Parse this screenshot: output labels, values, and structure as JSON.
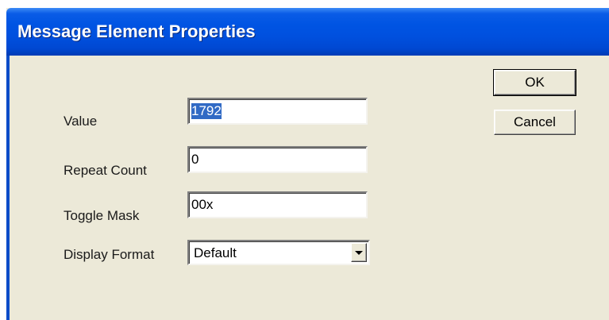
{
  "window": {
    "title": "Message Element Properties"
  },
  "fields": {
    "value": {
      "label": "Value",
      "text": "1792"
    },
    "repeat_count": {
      "label": "Repeat Count",
      "text": "0"
    },
    "toggle_mask": {
      "label": "Toggle Mask",
      "text": "00x"
    },
    "display_format": {
      "label": "Display Format",
      "selected": "Default"
    }
  },
  "buttons": {
    "ok": "OK",
    "cancel": "Cancel"
  },
  "colors": {
    "titlebar": "#0054e3",
    "dialog_background": "#ece9d8",
    "selection": "#316ac5"
  },
  "icons": {
    "dropdown": "chevron-down-icon"
  }
}
